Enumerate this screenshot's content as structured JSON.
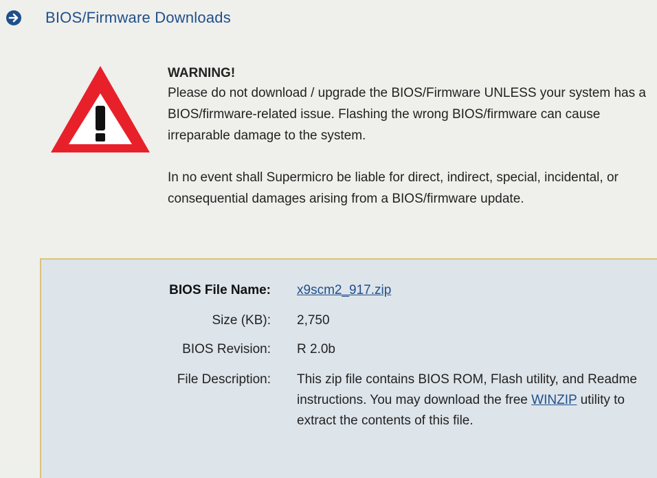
{
  "header": {
    "icon": "arrow-right-circle-icon",
    "title": "BIOS/Firmware Downloads",
    "accent_color": "#1f4f8a"
  },
  "warning": {
    "icon": "warning-triangle-icon",
    "icon_color": "#e8202a",
    "heading": "WARNING!",
    "paragraph1": "Please do not download / upgrade the BIOS/Firmware UNLESS your system has a BIOS/firmware-related issue. Flashing the wrong BIOS/firmware can cause irreparable damage to the system.",
    "paragraph2": "In no event shall Supermicro be liable for direct, indirect, special, incidental, or consequential damages arising from a BIOS/firmware update."
  },
  "file_info": {
    "file_name_label": "BIOS File Name:",
    "file_name": "x9scm2_917.zip",
    "size_label": "Size (KB):",
    "size": "2,750",
    "revision_label": "BIOS Revision:",
    "revision": "R 2.0b",
    "description_label": "File Description:",
    "description_before": "This zip file contains BIOS ROM, Flash utility, and Readme instructions. You may download the free ",
    "description_link": "WINZIP",
    "description_after": " utility to extract the contents of this file."
  }
}
